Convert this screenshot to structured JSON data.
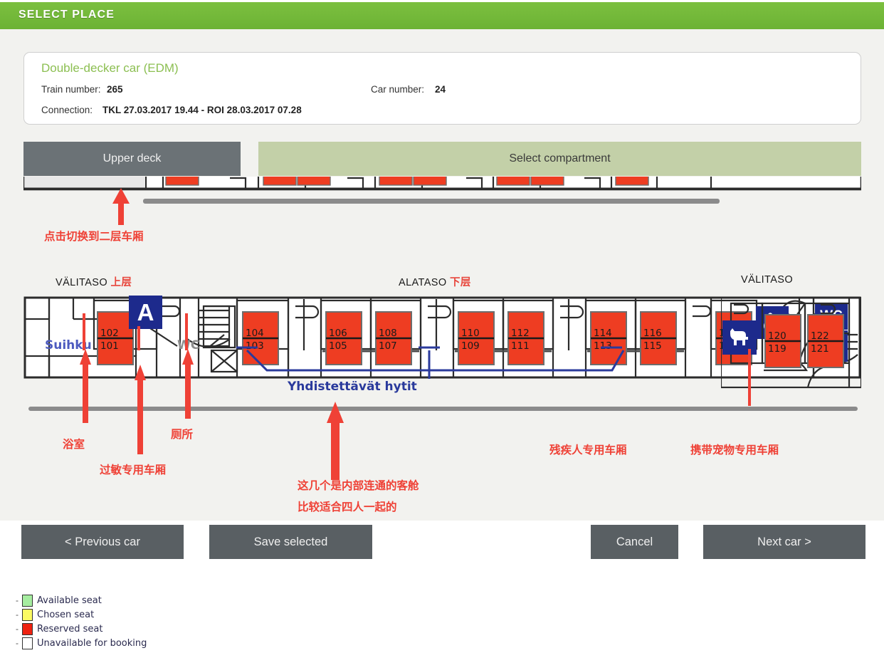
{
  "window": {
    "title": "SELECT PLACE",
    "accent_green": "#74b93a"
  },
  "info": {
    "car_type": "Double-decker car (EDM)",
    "train_number_label": "Train number:",
    "train_number_value": "265",
    "car_number_label": "Car number:",
    "car_number_value": "24",
    "connection_label": "Connection:",
    "connection_value": "TKL 27.03.2017 19.44 - ROI 28.03.2017 07.28"
  },
  "tabs": {
    "upper_deck": "Upper deck",
    "select_compartment": "Select compartment"
  },
  "deck_labels": {
    "left_fi": "VÄLITASO",
    "left_cn": "上层",
    "middle_fi": "ALATASO",
    "middle_cn": "下层",
    "right_fi": "VÄLITASO"
  },
  "diagram": {
    "shower_label": "Suihku",
    "wc_small_label": "WC",
    "wc_sign_label": "WC",
    "allergy_label": "A",
    "connectable_label": "Yhdistettävät hytit",
    "compartments": [
      {
        "upper": "102",
        "lower": "101",
        "state": "reserved"
      },
      {
        "upper": "104",
        "lower": "103",
        "state": "reserved"
      },
      {
        "upper": "106",
        "lower": "105",
        "state": "reserved"
      },
      {
        "upper": "108",
        "lower": "107",
        "state": "reserved"
      },
      {
        "upper": "110",
        "lower": "109",
        "state": "reserved"
      },
      {
        "upper": "112",
        "lower": "111",
        "state": "reserved"
      },
      {
        "upper": "114",
        "lower": "113",
        "state": "reserved"
      },
      {
        "upper": "116",
        "lower": "115",
        "state": "reserved"
      },
      {
        "upper": "118",
        "lower": "117",
        "state": "reserved"
      },
      {
        "upper": "120",
        "lower": "119",
        "state": "reserved"
      },
      {
        "upper": "122",
        "lower": "121",
        "state": "reserved"
      }
    ]
  },
  "annotations": [
    {
      "text": "点击切换到二层车厢"
    },
    {
      "text": "浴室"
    },
    {
      "text": "过敏专用车厢"
    },
    {
      "text": "厕所"
    },
    {
      "text": "这几个是内部连通的客舱"
    },
    {
      "text": "比较适合四人一起的"
    },
    {
      "text": "残疾人专用车厢"
    },
    {
      "text": "携带宠物专用车厢"
    }
  ],
  "buttons": {
    "previous_car": "< Previous car",
    "save_selected": "Save selected",
    "cancel": "Cancel",
    "next_car": "Next car >"
  },
  "legend": {
    "bullet": "-",
    "items": [
      {
        "label": "Available seat",
        "color": "#a6eda0"
      },
      {
        "label": "Chosen seat",
        "color": "#fbfa63"
      },
      {
        "label": "Reserved seat",
        "color": "#ee2211"
      },
      {
        "label": "Unavailable for booking",
        "color": "#ffffff"
      }
    ]
  },
  "colors": {
    "reserved_seat": "#ee3d22",
    "sign_blue": "#1d2a8c",
    "annotation_red": "#ef4136",
    "tab_grey": "#6b7276",
    "tab_green": "#c3d0a8"
  }
}
